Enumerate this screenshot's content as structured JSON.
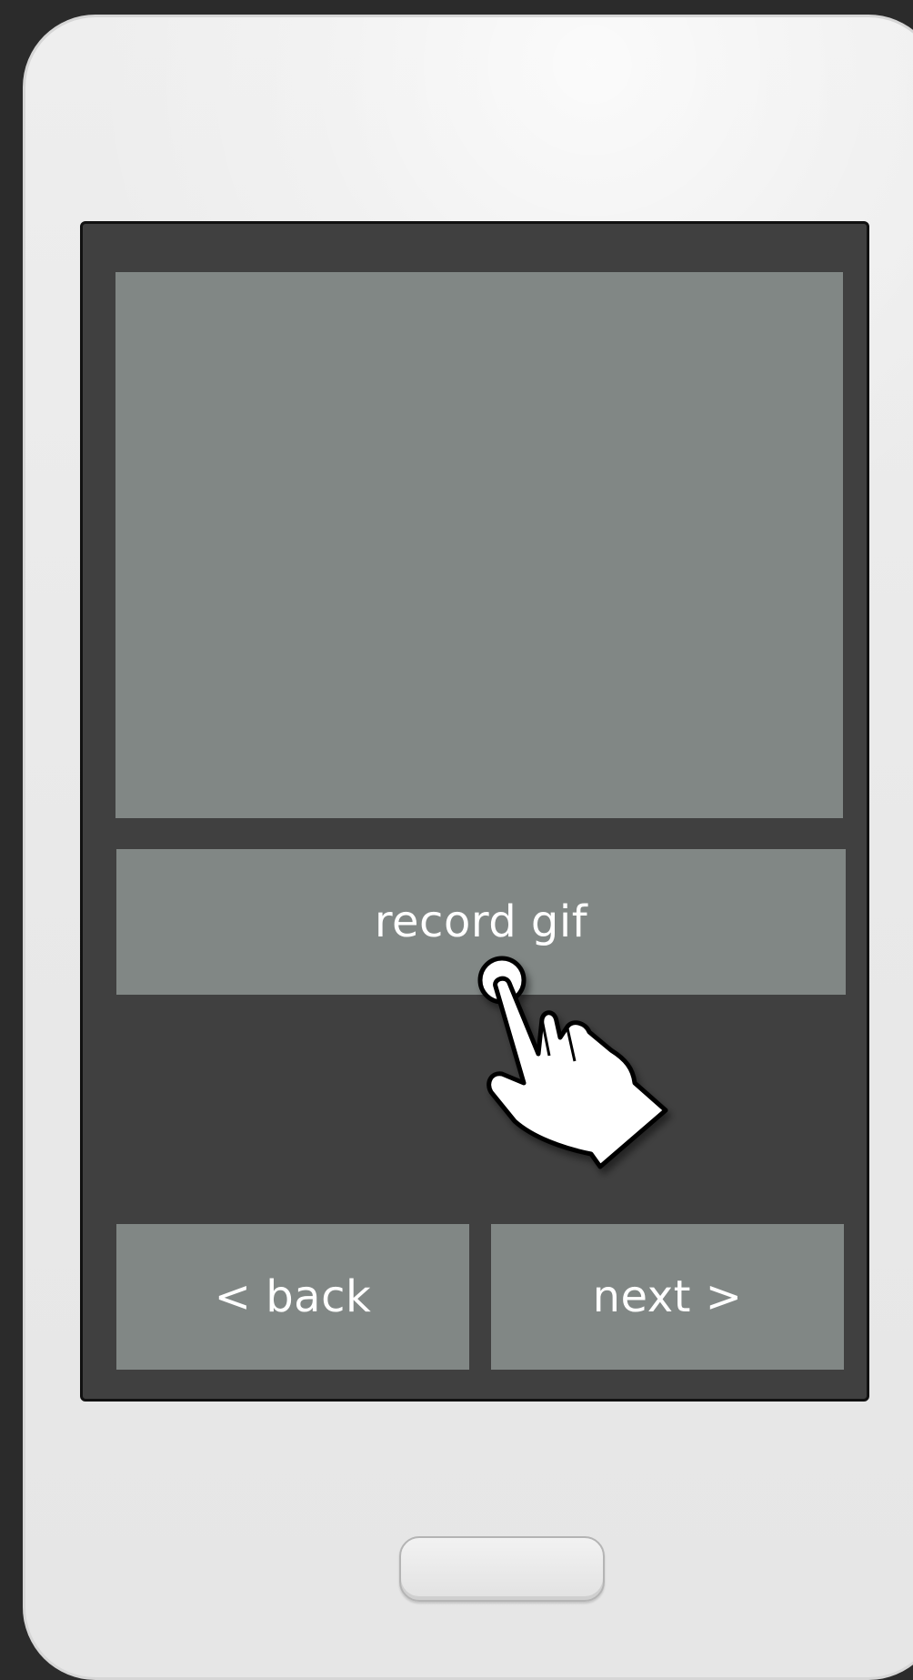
{
  "screen": {
    "record_button_label": "record gif",
    "back_button_label": "< back",
    "next_button_label": "next >"
  },
  "icons": {
    "hand_cursor": "tap-hand-icon",
    "home_button": "home-button"
  },
  "colors": {
    "screen_background": "#404040",
    "panel_gray": "#818785",
    "phone_body": "#e8e8e8",
    "page_background": "#2b2b2b",
    "text": "#ffffff"
  }
}
